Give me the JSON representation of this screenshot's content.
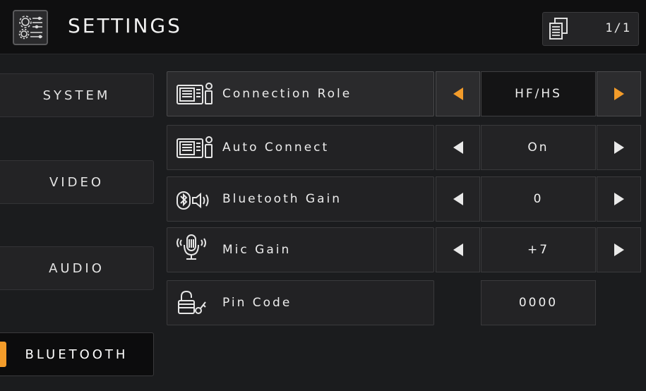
{
  "header": {
    "title": "SETTINGS",
    "app_icon": "settings-gears-icon",
    "page_icon": "pages-icon",
    "page_indicator": "1/1"
  },
  "sidebar": {
    "items": [
      {
        "label": "SYSTEM",
        "active": false
      },
      {
        "label": "VIDEO",
        "active": false
      },
      {
        "label": "AUDIO",
        "active": false
      },
      {
        "label": "BLUETOOTH",
        "active": true
      }
    ]
  },
  "settings": [
    {
      "label": "Connection Role",
      "icon": "head-unit-phone-icon",
      "value": "HF/HS",
      "selected": true,
      "has_arrows": true
    },
    {
      "label": "Auto Connect",
      "icon": "head-unit-phone-icon",
      "value": "On",
      "selected": false,
      "has_arrows": true
    },
    {
      "label": "Bluetooth Gain",
      "icon": "bluetooth-speaker-icon",
      "value": "0",
      "selected": false,
      "has_arrows": true
    },
    {
      "label": "Mic Gain",
      "icon": "microphone-icon",
      "value": "+7",
      "selected": false,
      "has_arrows": true
    },
    {
      "label": "Pin Code",
      "icon": "lock-key-icon",
      "value": "0000",
      "selected": false,
      "has_arrows": false
    }
  ],
  "colors": {
    "accent": "#f39c2a",
    "background": "#1b1c1e",
    "topbar": "#0f0f10"
  }
}
